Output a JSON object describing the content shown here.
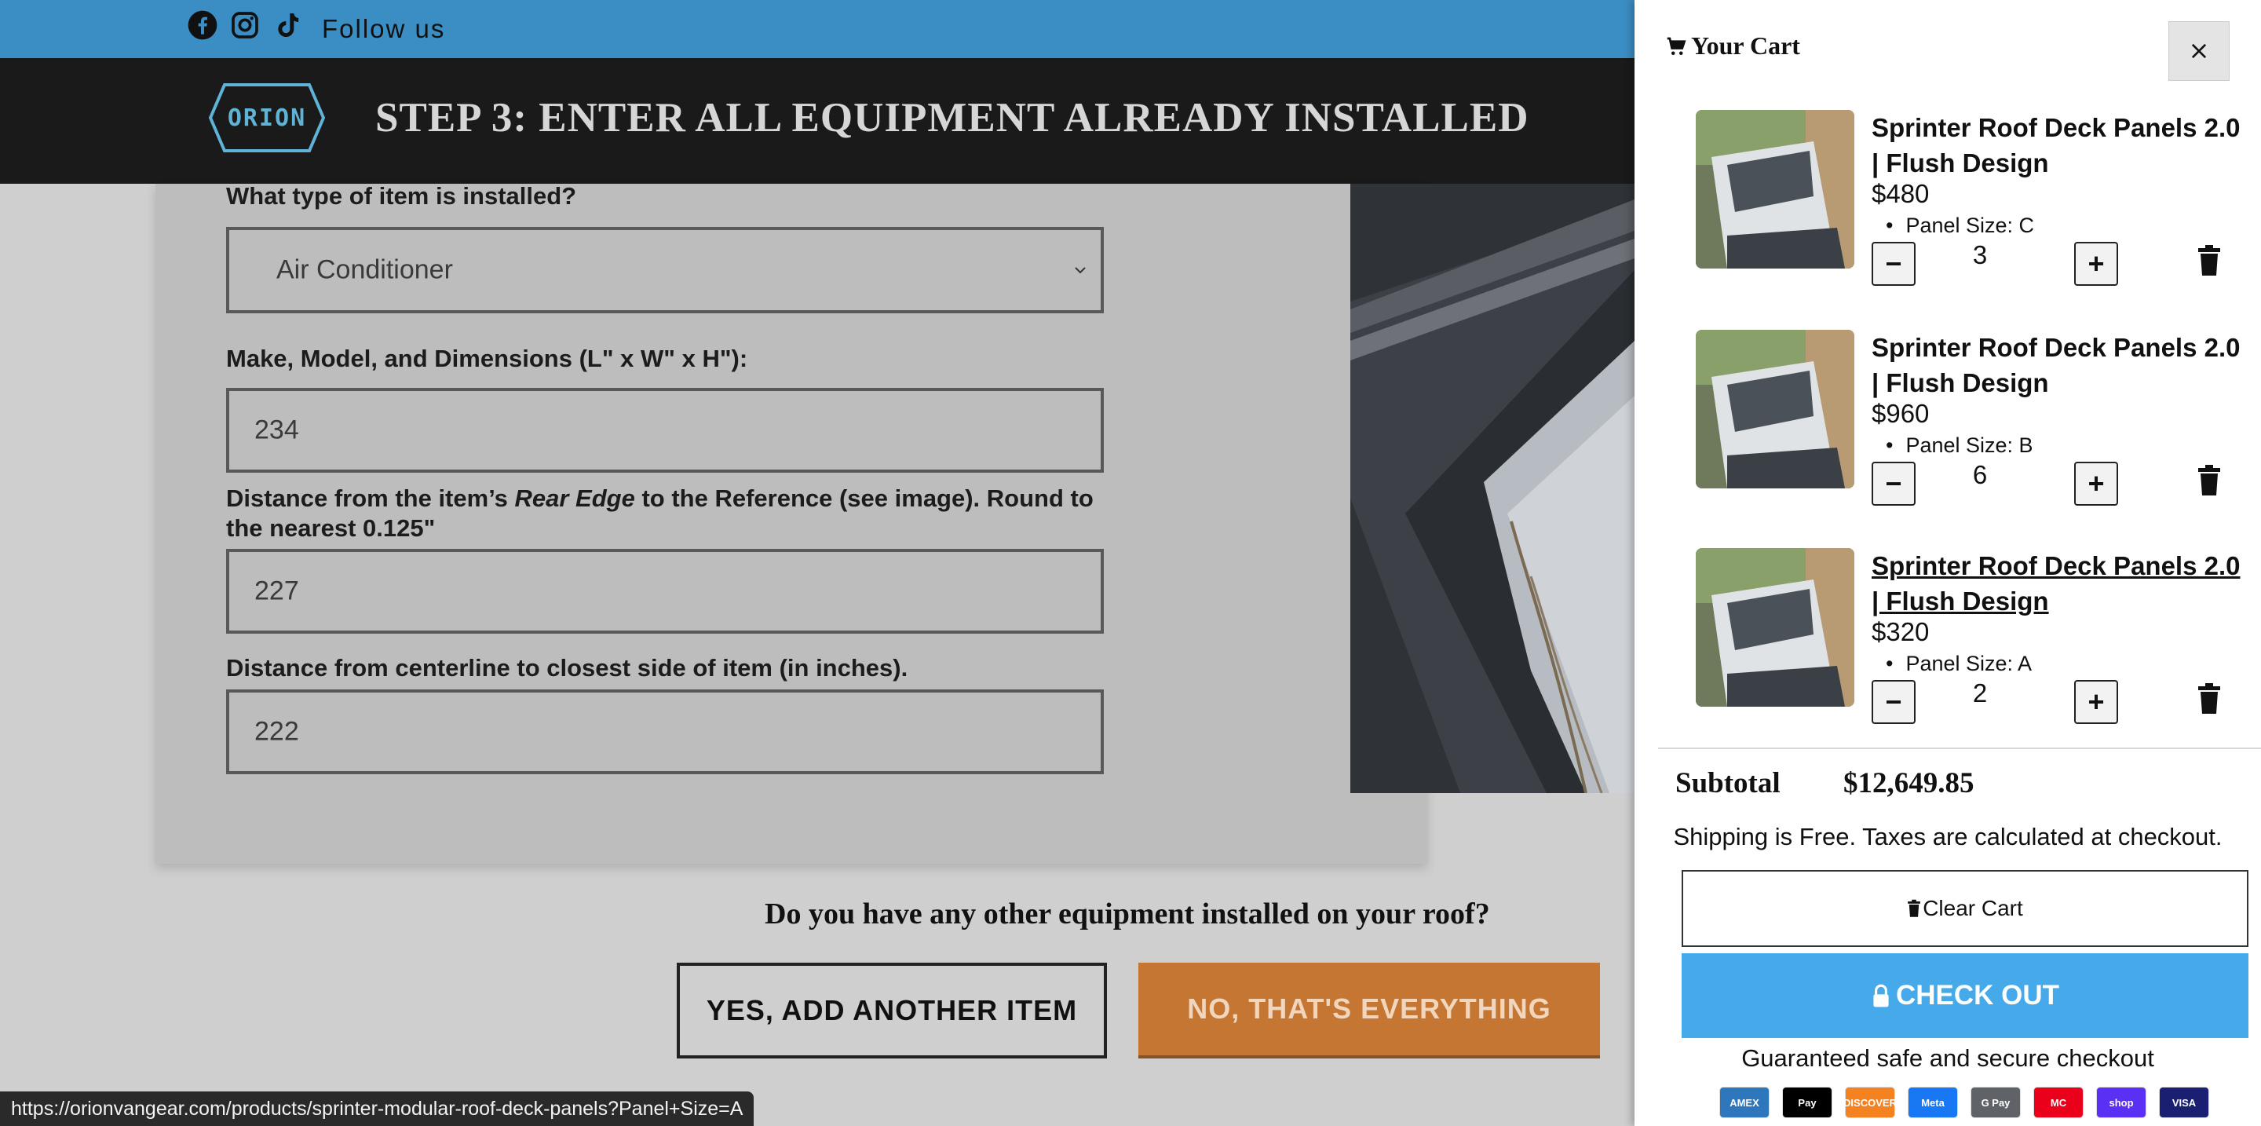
{
  "follow_bar": {
    "text": "Follow us",
    "icons": [
      "facebook-icon",
      "instagram-icon",
      "tiktok-icon"
    ]
  },
  "header": {
    "logo_text": "ORION",
    "step_title": "STEP 3: ENTER ALL EQUIPMENT ALREADY INSTALLED"
  },
  "form": {
    "item_type_label": "What type of item is installed?",
    "item_type_value": "Air Conditioner",
    "make_model_label": "Make, Model, and Dimensions (L\" x W\" x H\"):",
    "make_model_value": "234",
    "rear_edge_label_pre": "Distance from the item’s ",
    "rear_edge_label_em": "Rear Edge",
    "rear_edge_label_post": " to the Reference (see image). Round to the nearest 0.125\"",
    "rear_edge_value": "227",
    "centerline_label": "Distance from centerline to closest side of item (in inches).",
    "centerline_value": "222"
  },
  "question": {
    "text": "Do you have any other equipment installed on your roof?",
    "yes_label": "YES, ADD ANOTHER ITEM",
    "no_label": "NO, THAT'S EVERYTHING"
  },
  "status_url": "https://orionvangear.com/products/sprinter-modular-roof-deck-panels?Panel+Size=A",
  "cart": {
    "title": "Your Cart",
    "items": [
      {
        "title": "Sprinter Roof Deck Panels 2.0 | Flush Design",
        "price": "$480",
        "option": "Panel Size: C",
        "qty": "3"
      },
      {
        "title": "Sprinter Roof Deck Panels 2.0 | Flush Design",
        "price": "$960",
        "option": "Panel Size: B",
        "qty": "6"
      },
      {
        "title": "Sprinter Roof Deck Panels 2.0 | Flush Design",
        "price": "$320",
        "option": "Panel Size: A",
        "qty": "2"
      }
    ],
    "minus_symbol": "−",
    "plus_symbol": "+",
    "subtotal_label": "Subtotal",
    "subtotal_value": "$12,649.85",
    "shipping_note": "Shipping is Free. Taxes are calculated at checkout.",
    "clear_label": "Clear Cart",
    "checkout_label": "CHECK OUT",
    "secure_note": "Guaranteed safe and secure checkout",
    "payment_methods": [
      {
        "name": "AMEX",
        "color": "#2e77bc"
      },
      {
        "name": "Pay",
        "color": "#000000"
      },
      {
        "name": "DISCOVER",
        "color": "#f58220"
      },
      {
        "name": "Meta",
        "color": "#1877f2"
      },
      {
        "name": "G Pay",
        "color": "#5f6368"
      },
      {
        "name": "MC",
        "color": "#eb001b"
      },
      {
        "name": "shop",
        "color": "#5a31f4"
      },
      {
        "name": "VISA",
        "color": "#1a1f71"
      }
    ]
  },
  "colors": {
    "follow_bar": "#3b8ec4",
    "header": "#1a1a1a",
    "accent_orange": "#c47632",
    "checkout_blue": "#45a9ea"
  }
}
